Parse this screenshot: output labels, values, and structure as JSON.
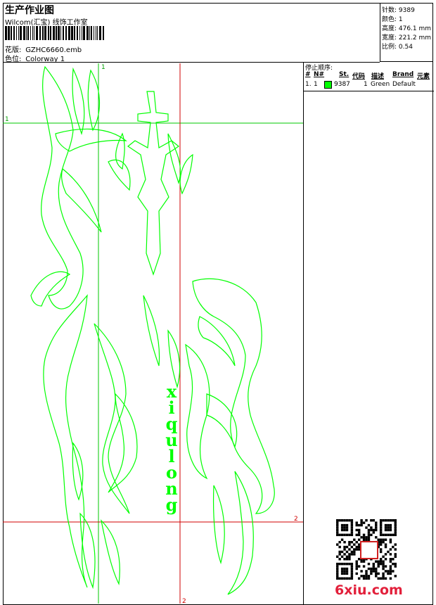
{
  "header": {
    "title": "生产作业图",
    "company": "Wilcom(汇宝) 线饰工作室",
    "pattern_label": "花版:",
    "pattern_value": "GZHC6660.emb",
    "color_label": "色位:",
    "color_value": "Colorway 1"
  },
  "specs": {
    "stitches": "针数: 9389",
    "colors": "颜色: 1",
    "height": "高度: 476.1 mm",
    "width": "宽度: 221.2 mm",
    "scale": "比例: 0.54"
  },
  "stop_sequence": {
    "title": "停止顺序:",
    "headers": [
      "#",
      "N#",
      "St.",
      "代码",
      "描述",
      "Brand",
      "元素"
    ],
    "rows": [
      {
        "index": "1.",
        "needle": "1",
        "stitches": "9387",
        "code": "1",
        "description": "Green",
        "brand": "Default",
        "swatch": "#00ff00"
      }
    ]
  },
  "design": {
    "text": "xiqulong",
    "stitch_color": "#00ff00",
    "guide_green": "#00c800",
    "guide_red": "#d00000",
    "guide_labels": {
      "v1": "1",
      "h1": "1",
      "h2": "2",
      "v2": "2"
    }
  },
  "watermark": "6xiu.com"
}
